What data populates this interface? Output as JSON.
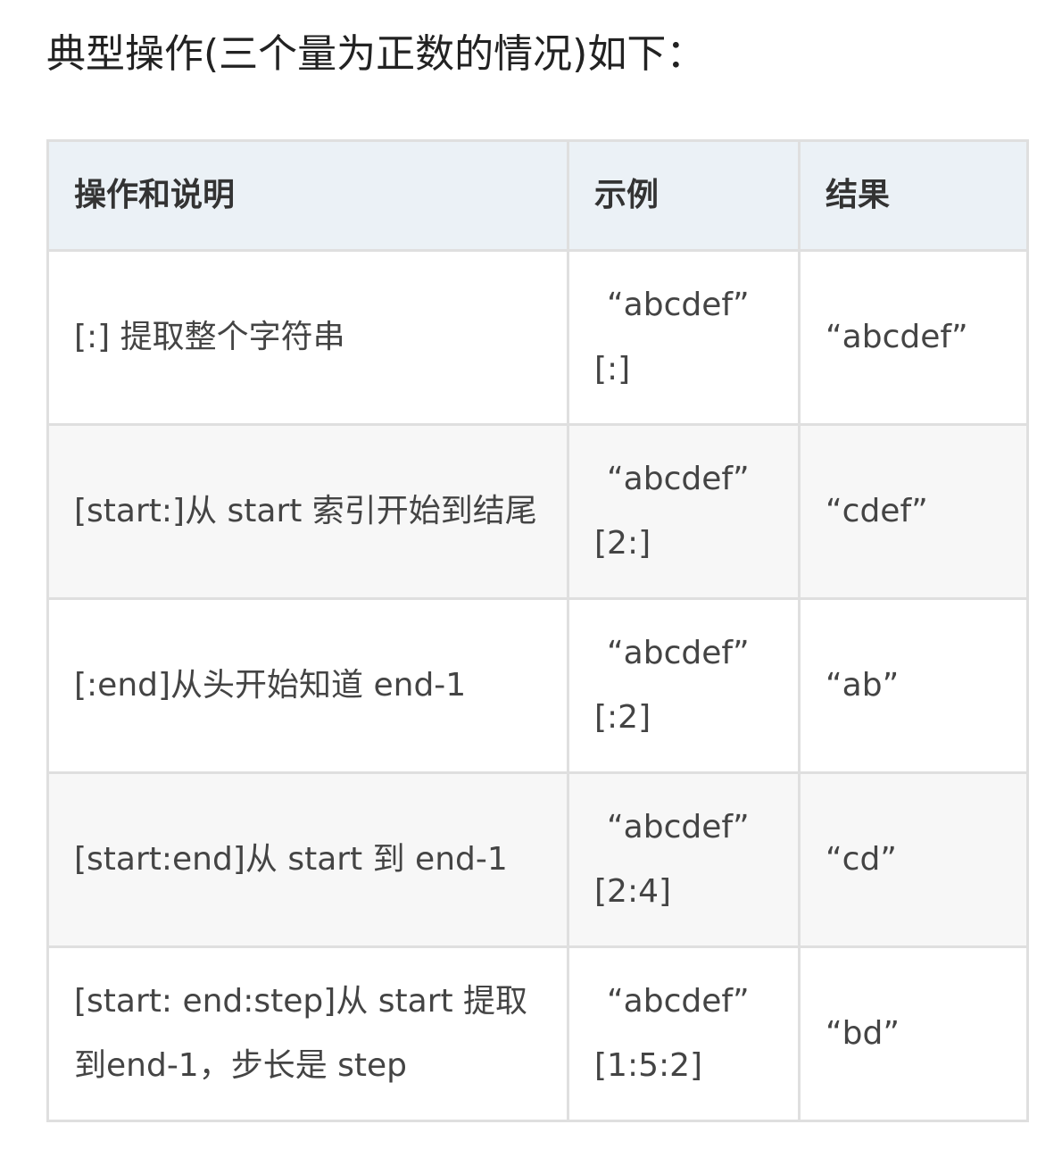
{
  "heading": "典型操作(三个量为正数的情况)如下：",
  "table": {
    "headers": [
      "操作和说明",
      "示例",
      "结果"
    ],
    "rows": [
      {
        "op": "[:] 提取整个字符串",
        "example_str": "“abcdef”",
        "example_slice": "[:]",
        "result": "“abcdef”"
      },
      {
        "op": "[start:]从 start 索引开始到结尾",
        "example_str": "“abcdef”",
        "example_slice": "[2:]",
        "result": "“cdef”"
      },
      {
        "op": "[:end]从头开始知道 end-1",
        "example_str": "“abcdef”",
        "example_slice": "[:2]",
        "result": "“ab”"
      },
      {
        "op": "[start:end]从 start 到 end-1",
        "example_str": "“abcdef”",
        "example_slice": "[2:4]",
        "result": "“cd”"
      },
      {
        "op": "[start: end:step]从 start 提取到end-1，步长是 step",
        "example_str": "“abcdef”",
        "example_slice": "[1:5:2]",
        "result": "“bd”"
      }
    ]
  }
}
